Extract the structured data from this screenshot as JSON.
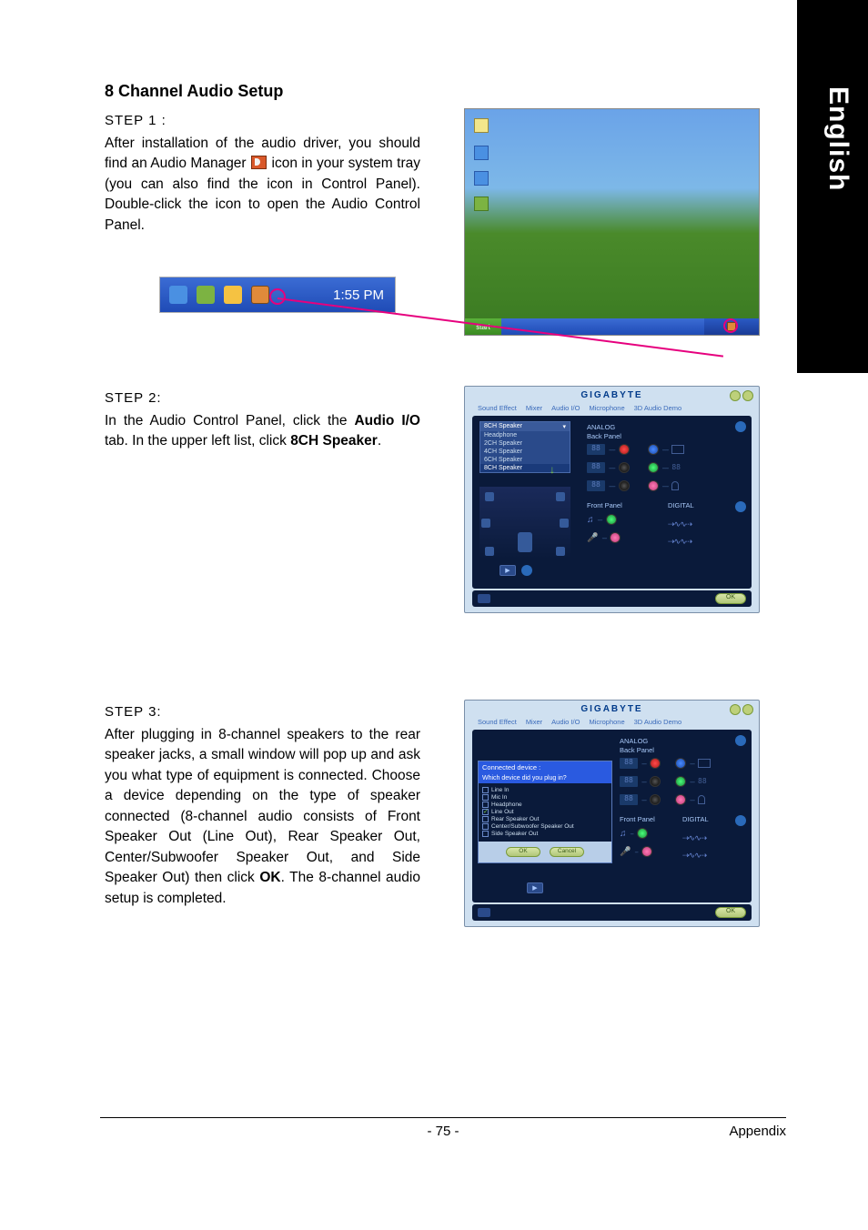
{
  "sidebar": {
    "language": "English"
  },
  "title": "8 Channel Audio Setup",
  "step1": {
    "label": "STEP 1 :",
    "text_before_icon": "After installation of the audio driver, you should find an Audio Manager",
    "text_after_icon": "icon in your system tray (you can also find the icon in Control Panel).  Double-click the icon to open the Audio Control Panel.",
    "tray_time": "1:55 PM",
    "desktop": {
      "start_label": "start"
    }
  },
  "step2": {
    "label": "STEP 2:",
    "text_part1": "In the Audio Control Panel, click the ",
    "bold1": "Audio I/O",
    "text_part2": " tab. In the upper left list, click ",
    "bold2": "8CH Speaker",
    "text_part3": "."
  },
  "step3": {
    "label": "STEP 3:",
    "text_part1": "After plugging in 8-channel speakers to the rear speaker jacks, a small window will pop up and ask you what type of equipment is connected. Choose a device depending on the type of speaker connected (8-channel audio consists of Front Speaker Out (Line Out), Rear Speaker Out, Center/Subwoofer Speaker Out, and Side Speaker Out) then click ",
    "bold1": "OK",
    "text_part2": ". The 8-channel audio setup is completed."
  },
  "audio_panel": {
    "brand": "GIGABYTE",
    "tabs": [
      "Sound Effect",
      "Mixer",
      "Audio I/O",
      "Microphone",
      "3D Audio Demo"
    ],
    "dropdown_selected": "8CH Speaker",
    "dropdown_options": [
      "Headphone",
      "2CH Speaker",
      "4CH Speaker",
      "6CH Speaker",
      "8CH Speaker"
    ],
    "analog_label": "ANALOG",
    "back_panel_label": "Back Panel",
    "front_panel_label": "Front Panel",
    "digital_label": "DIGITAL",
    "ok_label": "OK"
  },
  "connected_dialog": {
    "title": "Connected device :",
    "question": "Which device did you plug in?",
    "options": [
      {
        "label": "Line In",
        "checked": false
      },
      {
        "label": "Mic In",
        "checked": false
      },
      {
        "label": "Headphone",
        "checked": false
      },
      {
        "label": "Line Out",
        "checked": true
      },
      {
        "label": "Rear Speaker Out",
        "checked": false
      },
      {
        "label": "Center/Subwoofer Speaker Out",
        "checked": false
      },
      {
        "label": "Side Speaker Out",
        "checked": false
      }
    ],
    "ok_label": "OK",
    "cancel_label": "Cancel"
  },
  "footer": {
    "page": "- 75 -",
    "section": "Appendix"
  }
}
